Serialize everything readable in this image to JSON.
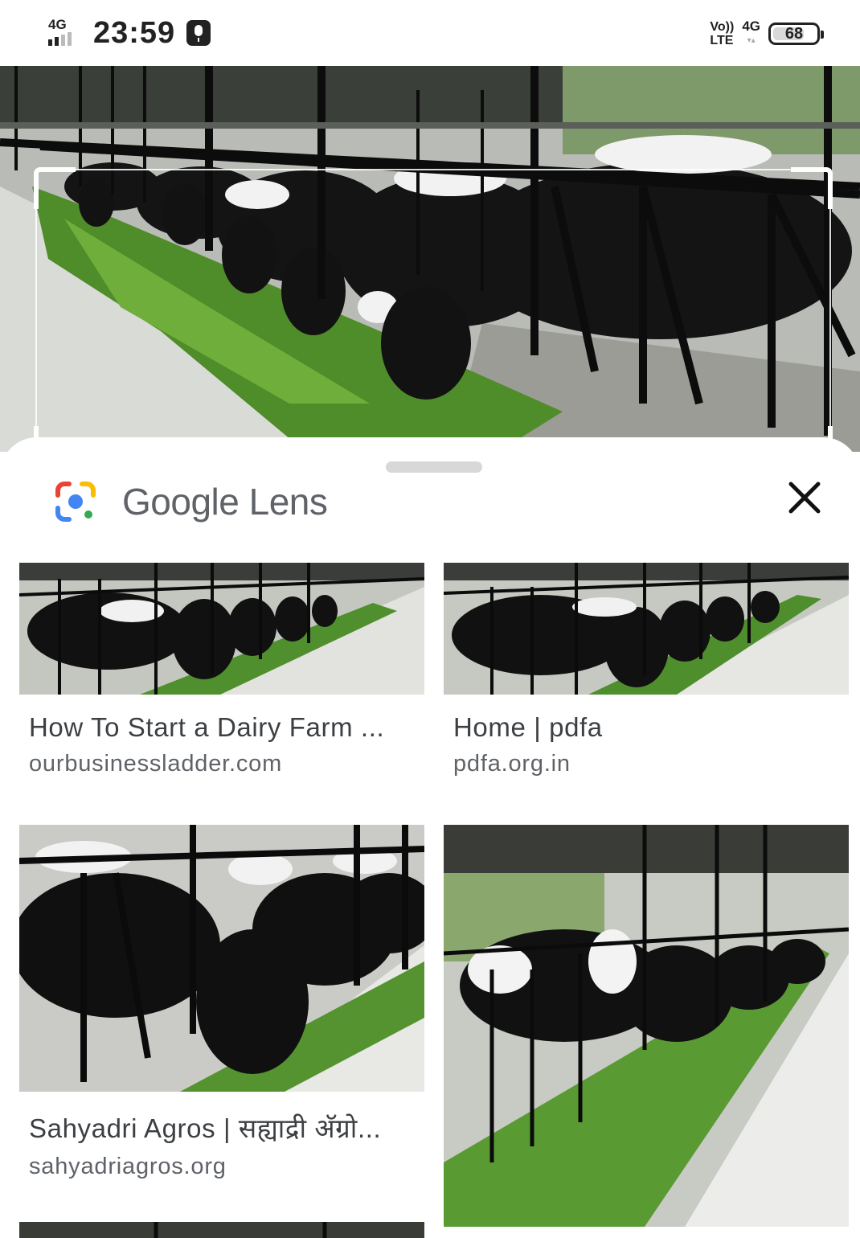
{
  "status_bar": {
    "network_label": "4G",
    "time": "23:59",
    "volte_top": "Vo))",
    "volte_bottom": "LTE",
    "network_right": "4G",
    "battery": "68"
  },
  "lens": {
    "title_google": "Google",
    "title_lens": "Lens",
    "close_icon": "close-icon",
    "logo_icon": "google-lens-icon"
  },
  "results": [
    {
      "title": "How To Start a Dairy Farm ...",
      "domain": "ourbusinessladder.com"
    },
    {
      "title": "Home | pdfa",
      "domain": "pdfa.org.in"
    },
    {
      "title": "Sahyadri Agros | सह्याद्री अ‍ॅग्रो...",
      "domain": "sahyadriagros.org"
    },
    {
      "title": "",
      "domain": ""
    }
  ],
  "colors": {
    "lens_blue": "#4285F4",
    "lens_red": "#EA4335",
    "lens_yellow": "#FBBC04",
    "lens_green": "#34A853",
    "title_gray": "#5f6368"
  }
}
